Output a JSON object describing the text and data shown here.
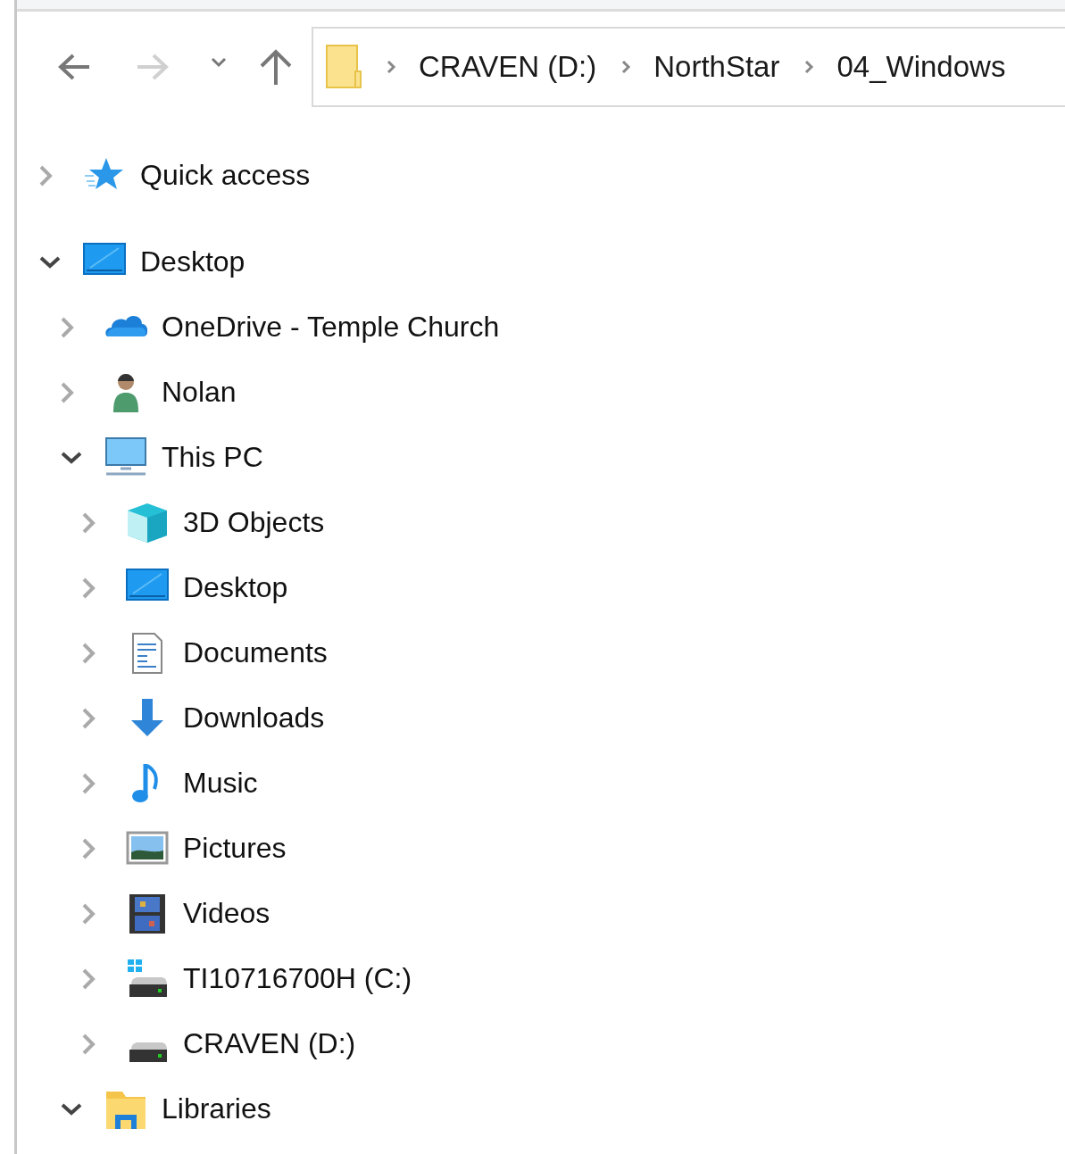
{
  "navigation": [
    {
      "kind": "back",
      "disabled": false
    },
    {
      "kind": "forward",
      "disabled": true
    },
    {
      "kind": "recent",
      "disabled": false
    },
    {
      "kind": "up",
      "disabled": false
    }
  ],
  "address_bar": {
    "path": [
      "CRAVEN (D:)",
      "NorthStar",
      "04_Windows"
    ]
  },
  "tree": [
    {
      "label": "Quick access",
      "kind": "quick-access",
      "expanded": false
    },
    {
      "label": "Desktop",
      "kind": "desktop",
      "expanded": true,
      "children": [
        {
          "label": "OneDrive - Temple Church",
          "kind": "cloud",
          "expanded": false
        },
        {
          "label": "Nolan",
          "kind": "user",
          "expanded": false
        },
        {
          "label": "This PC",
          "kind": "pc",
          "expanded": true,
          "children": [
            {
              "label": "3D Objects",
              "kind": "cube",
              "expanded": false
            },
            {
              "label": "Desktop",
              "kind": "desktop",
              "expanded": false
            },
            {
              "label": "Documents",
              "kind": "document",
              "expanded": false
            },
            {
              "label": "Downloads",
              "kind": "download",
              "expanded": false
            },
            {
              "label": "Music",
              "kind": "music",
              "expanded": false
            },
            {
              "label": "Pictures",
              "kind": "pictures",
              "expanded": false
            },
            {
              "label": "Videos",
              "kind": "videos",
              "expanded": false
            },
            {
              "label": "TI10716700H (C:)",
              "kind": "system-drive",
              "expanded": false
            },
            {
              "label": "CRAVEN (D:)",
              "kind": "drive",
              "expanded": false
            }
          ]
        },
        {
          "label": "Libraries",
          "kind": "library",
          "expanded": true
        }
      ]
    }
  ]
}
